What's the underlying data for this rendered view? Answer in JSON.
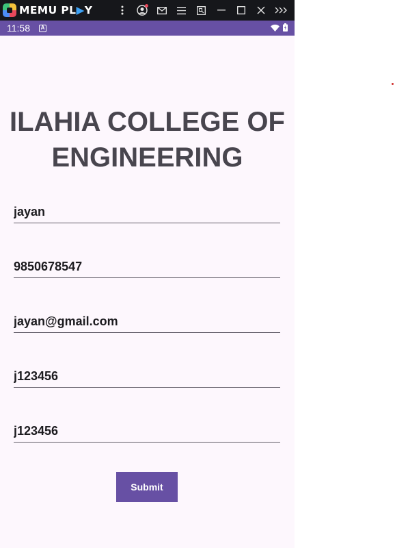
{
  "emulator": {
    "title_main": "MEMU PL",
    "title_tri": "▶",
    "title_end": "Y",
    "icons": [
      "more-vert-icon",
      "account-icon",
      "mail-icon",
      "menu-icon",
      "screenshot-icon",
      "minimize-icon",
      "maximize-icon",
      "close-icon",
      "expand-icon"
    ]
  },
  "status_bar": {
    "time": "11:58",
    "a_badge": "A"
  },
  "form": {
    "title": "ILAHIA COLLEGE OF ENGINEERING",
    "fields": [
      {
        "value": "jayan"
      },
      {
        "value": "9850678547"
      },
      {
        "value": "jayan@gmail.com"
      },
      {
        "value": "j123456"
      },
      {
        "value": "j123456"
      }
    ],
    "submit_label": "Submit"
  },
  "colors": {
    "status_bar": "#6750a4",
    "button": "#6750a4",
    "background": "#fdf7fd",
    "emulator_bar": "#16171b"
  }
}
